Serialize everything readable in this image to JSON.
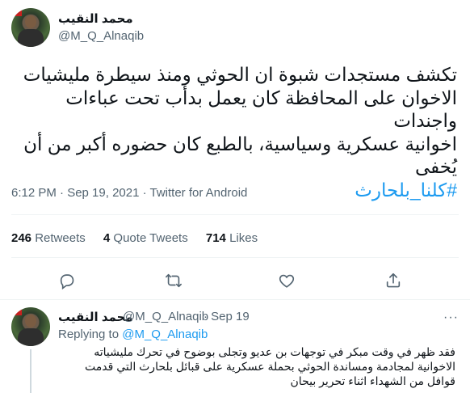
{
  "tweet": {
    "author_name": "محمد النقيب",
    "author_handle": "@M_Q_Alnaqib",
    "text_lines": [
      "تكشف مستجدات شبوة ان الحوثي ومنذ سيطرة مليشيات",
      "الاخوان على المحافظة كان يعمل بدأب تحت عباءات واجندات",
      "اخوانية عسكرية وسياسية، بالطبع كان حضوره أكبر من أن",
      "يُخفى"
    ],
    "hashtag": "#كلنا_بلحارث",
    "timestamp": "6:12 PM · Sep 19, 2021 · Twitter for Android",
    "stats": {
      "retweets_count": "246",
      "retweets_label": "Retweets",
      "quotes_count": "4",
      "quotes_label": "Quote Tweets",
      "likes_count": "714",
      "likes_label": "Likes"
    },
    "icons": [
      "reply-icon",
      "retweet-icon",
      "like-icon",
      "share-icon"
    ],
    "accent_color": "#1d9bf0"
  },
  "reply": {
    "author_name": "محمد النقيب",
    "author_handle": "@M_Q_Alnaqib",
    "date": "· Sep 19",
    "replying_label": "Replying to",
    "replying_handle": "@M_Q_Alnaqib",
    "text_lines": [
      "فقد ظهر في وقت مبكر في توجهات بن عديو وتجلى بوضوح في تحرك مليشياته",
      "الاخوانية لمجادمة ومساندة الحوثي بحملة عسكرية على قبائل بلحارث التي قدمت",
      "قوافل من الشهداء اثناء تحرير بيحان"
    ]
  }
}
